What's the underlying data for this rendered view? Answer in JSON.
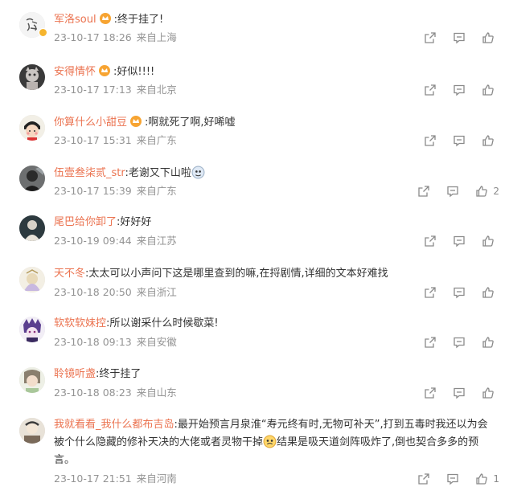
{
  "comments": [
    {
      "name": "军洛soul",
      "vip": true,
      "text": ":终于挂了!",
      "time": "23-10-17 18:26",
      "loc": "来自上海",
      "likes": ""
    },
    {
      "name": "安得情怀",
      "vip": true,
      "text": ":好似!!!!",
      "time": "23-10-17 17:13",
      "loc": "来自北京",
      "likes": ""
    },
    {
      "name": "你算什么小甜豆",
      "vip": true,
      "text": ":啊就死了啊,好唏嘘",
      "time": "23-10-17 15:31",
      "loc": "来自广东",
      "likes": ""
    },
    {
      "name": "伍壹叁柒贰_str",
      "vip": false,
      "text": ":老谢又下山啦",
      "time": "23-10-17 15:39",
      "loc": "来自广东",
      "likes": "2"
    },
    {
      "name": "尾巴给你卸了",
      "vip": false,
      "text": ":好好好",
      "time": "23-10-19 09:44",
      "loc": "来自江苏",
      "likes": ""
    },
    {
      "name": "天不冬",
      "vip": false,
      "text": ":太太可以小声问下这是哪里查到的嘛,在捋剧情,详细的文本好难找",
      "time": "23-10-18 20:50",
      "loc": "来自浙江",
      "likes": ""
    },
    {
      "name": "软软软妹控",
      "vip": false,
      "text": ":所以谢采什么时候歇菜!",
      "time": "23-10-18 09:13",
      "loc": "来自安徽",
      "likes": ""
    },
    {
      "name": "聆镜听盏",
      "vip": false,
      "text": ":终于挂了",
      "time": "23-10-18 08:23",
      "loc": "来自山东",
      "likes": ""
    },
    {
      "name": "我就看看_我什么都布吉岛",
      "vip": false,
      "text": ":最开始预言月泉淮“寿元终有时,无物可补天”,打到五毒时我还以为会被个什么隐藏的修补天决的大佬或者灵物干掉",
      "text2": "结果是吸天道剑阵吸炸了,倒也契合多多的预言。",
      "time": "23-10-17 21:51",
      "loc": "来自河南",
      "likes": "1"
    }
  ],
  "icons": {
    "share": "share-icon",
    "reply": "comment-icon",
    "like": "thumbs-up-icon"
  },
  "colors": {
    "username": "#eb7350",
    "meta": "#939393",
    "icon": "#8a8a8a",
    "text": "#333333"
  }
}
